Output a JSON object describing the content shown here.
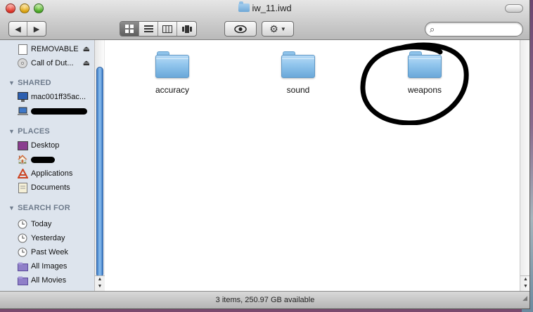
{
  "window": {
    "title": "iw_11.iwd"
  },
  "toolbar": {
    "back_icon": "◀",
    "forward_icon": "▶",
    "view_icons": "icon, list, column, coverflow",
    "quicklook_icon": "eye-icon",
    "action_icon": "gear-icon",
    "search_placeholder": ""
  },
  "sidebar": {
    "devices": [
      {
        "label": "REMOVABLE",
        "icon": "drive-icon",
        "eject": true
      },
      {
        "label": "Call of Dut...",
        "icon": "disc-icon",
        "eject": true
      }
    ],
    "shared_header": "SHARED",
    "shared": [
      {
        "label": "mac001ff35ac...",
        "icon": "computer-icon"
      },
      {
        "label": "",
        "icon": "laptop-icon",
        "redacted": true
      }
    ],
    "places_header": "PLACES",
    "places": [
      {
        "label": "Desktop",
        "icon": "desktop-icon"
      },
      {
        "label": "",
        "icon": "home-icon",
        "redacted": true
      },
      {
        "label": "Applications",
        "icon": "applications-icon"
      },
      {
        "label": "Documents",
        "icon": "documents-icon"
      }
    ],
    "search_header": "SEARCH FOR",
    "searches": [
      {
        "label": "Today",
        "icon": "clock-icon"
      },
      {
        "label": "Yesterday",
        "icon": "clock-icon"
      },
      {
        "label": "Past Week",
        "icon": "clock-icon"
      },
      {
        "label": "All Images",
        "icon": "smart-folder-icon"
      },
      {
        "label": "All Movies",
        "icon": "smart-folder-icon"
      }
    ]
  },
  "content": {
    "folders": [
      {
        "name": "accuracy"
      },
      {
        "name": "sound"
      },
      {
        "name": "weapons",
        "circled": true
      }
    ]
  },
  "status": {
    "text": "3 items, 250.97 GB available"
  },
  "colors": {
    "sidebar_bg": "#dde4ed",
    "sidebar_header": "#6e7b8c",
    "folder_blue": "#8fc4ec",
    "scroll_thumb": "#3f7ec8"
  }
}
